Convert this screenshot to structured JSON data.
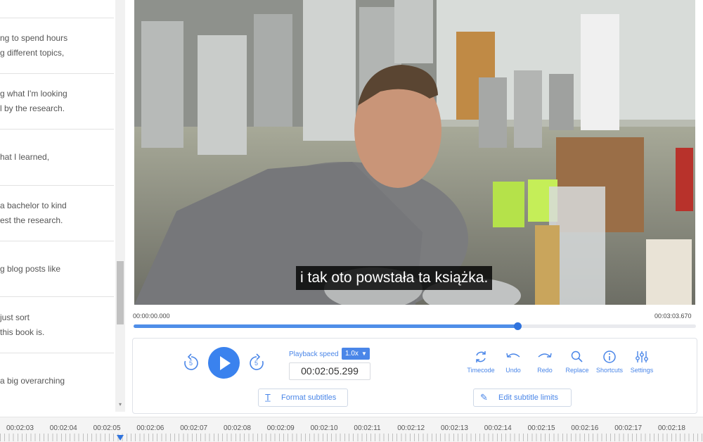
{
  "segments": [
    {
      "lines": [
        "ng to spend hours",
        "g different topics,"
      ]
    },
    {
      "lines": [
        "g what I'm looking",
        "l by the research."
      ]
    },
    {
      "lines": [
        "hat I learned,"
      ]
    },
    {
      "lines": [
        "a bachelor to kind",
        "est the research."
      ]
    },
    {
      "lines": [
        "g blog posts like"
      ]
    },
    {
      "lines": [
        "just sort",
        "this book is."
      ]
    },
    {
      "lines": [
        "a big overarching"
      ]
    }
  ],
  "video": {
    "subtitle": "i tak oto powstała ta książka.",
    "start_time": "00:00:00.000",
    "end_time": "00:03:03.670",
    "progress": 0.682
  },
  "controls": {
    "rewind_seconds": "5",
    "forward_seconds": "5",
    "playback_speed_label": "Playback speed",
    "playback_speed_value": "1.0x",
    "current_time": "00:02:05.299",
    "tools": [
      {
        "label": "Timecode",
        "icon": "timecode-icon"
      },
      {
        "label": "Undo",
        "icon": "undo-icon"
      },
      {
        "label": "Redo",
        "icon": "redo-icon"
      },
      {
        "label": "Replace",
        "icon": "search-icon"
      },
      {
        "label": "Shortcuts",
        "icon": "info-icon"
      },
      {
        "label": "Settings",
        "icon": "sliders-icon"
      }
    ],
    "format_subtitles_label": "Format subtitles",
    "edit_limits_label": "Edit subtitle limits"
  },
  "ruler": {
    "labels": [
      "00:02:03",
      "00:02:04",
      "00:02:05",
      "00:02:06",
      "00:02:07",
      "00:02:08",
      "00:02:09",
      "00:02:10",
      "00:02:11",
      "00:02:12",
      "00:02:13",
      "00:02:14",
      "00:02:15",
      "00:02:16",
      "00:02:17",
      "00:02:18"
    ]
  },
  "colors": {
    "accent": "#3a82ee"
  }
}
